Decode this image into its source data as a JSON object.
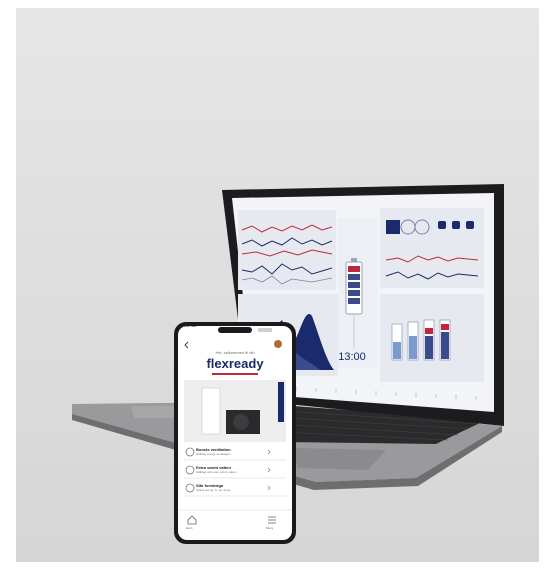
{
  "phone": {
    "time": "09:12",
    "greeting": "Hei, velkommen til din",
    "brand": "flexready",
    "list": [
      {
        "title": "Boosts ventilation",
        "sub": "Hälldag energi ventilasjon"
      },
      {
        "title": "Extra varmt vatten",
        "sub": "Hälldag vatn som varmt vatten"
      },
      {
        "title": "Slår forvärdga",
        "sub": "Spara energi, fx. str. fruite"
      }
    ],
    "nav": [
      {
        "label": "Hem",
        "icon": "home-icon"
      },
      {
        "label": "Meny",
        "icon": "menu-icon"
      }
    ]
  },
  "laptop": {
    "clock": "13:00"
  },
  "colors": {
    "brand_red": "#c0283a",
    "dark_navy": "#1a2a6b",
    "screen_bg": "#f2f4f7"
  }
}
